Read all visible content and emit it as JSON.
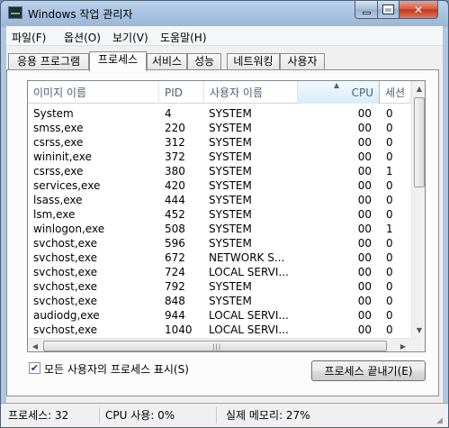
{
  "window": {
    "title": "Windows 작업 관리자",
    "minimize_glyph": "minimize-icon",
    "maximize_glyph": "maximize-icon",
    "close_glyph": "✕"
  },
  "menu": [
    "파일(F)",
    "옵션(O)",
    "보기(V)",
    "도움말(H)"
  ],
  "tabs": [
    {
      "label": "응용 프로그램",
      "active": false
    },
    {
      "label": "프로세스",
      "active": true
    },
    {
      "label": "서비스",
      "active": false
    },
    {
      "label": "성능",
      "active": false
    },
    {
      "label": "네트워킹",
      "active": false
    },
    {
      "label": "사용자",
      "active": false
    }
  ],
  "table": {
    "columns": [
      "이미지 이름",
      "PID",
      "사용자 이름",
      "CPU",
      "세션"
    ],
    "sorted_column": "CPU",
    "rows": [
      {
        "name": "System",
        "pid": "4",
        "user": "SYSTEM",
        "cpu": "00",
        "session": "0"
      },
      {
        "name": "smss,exe",
        "pid": "220",
        "user": "SYSTEM",
        "cpu": "00",
        "session": "0"
      },
      {
        "name": "csrss,exe",
        "pid": "312",
        "user": "SYSTEM",
        "cpu": "00",
        "session": "0"
      },
      {
        "name": "wininit,exe",
        "pid": "372",
        "user": "SYSTEM",
        "cpu": "00",
        "session": "0"
      },
      {
        "name": "csrss,exe",
        "pid": "380",
        "user": "SYSTEM",
        "cpu": "00",
        "session": "1"
      },
      {
        "name": "services,exe",
        "pid": "420",
        "user": "SYSTEM",
        "cpu": "00",
        "session": "0"
      },
      {
        "name": "lsass,exe",
        "pid": "444",
        "user": "SYSTEM",
        "cpu": "00",
        "session": "0"
      },
      {
        "name": "lsm,exe",
        "pid": "452",
        "user": "SYSTEM",
        "cpu": "00",
        "session": "0"
      },
      {
        "name": "winlogon,exe",
        "pid": "508",
        "user": "SYSTEM",
        "cpu": "00",
        "session": "1"
      },
      {
        "name": "svchost,exe",
        "pid": "596",
        "user": "SYSTEM",
        "cpu": "00",
        "session": "0"
      },
      {
        "name": "svchost,exe",
        "pid": "672",
        "user": "NETWORK S...",
        "cpu": "00",
        "session": "0"
      },
      {
        "name": "svchost,exe",
        "pid": "724",
        "user": "LOCAL SERVI...",
        "cpu": "00",
        "session": "0"
      },
      {
        "name": "svchost,exe",
        "pid": "792",
        "user": "SYSTEM",
        "cpu": "00",
        "session": "0"
      },
      {
        "name": "svchost,exe",
        "pid": "848",
        "user": "SYSTEM",
        "cpu": "00",
        "session": "0"
      },
      {
        "name": "audiodg,exe",
        "pid": "944",
        "user": "LOCAL SERVI...",
        "cpu": "00",
        "session": "0"
      },
      {
        "name": "svchost,exe",
        "pid": "1040",
        "user": "LOCAL SERVI...",
        "cpu": "00",
        "session": "0"
      }
    ]
  },
  "scroll_grip": "|||",
  "show_all_processes": {
    "label": "모든 사용자의 프로세스 표시(S)",
    "checked": true,
    "check_glyph": "✔"
  },
  "end_process_button": "프로세스 끝내기(E)",
  "status": {
    "processes": "프로세스: 32",
    "cpu_usage": "CPU 사용: 0%",
    "memory": "실제 메모리: 27%"
  },
  "icons": {
    "app": "task-manager-icon",
    "sort": "sort-ascending-icon",
    "scroll_up": "chevron-up-icon",
    "scroll_down": "chevron-down-icon",
    "scroll_left": "chevron-left-icon",
    "scroll_right": "chevron-right-icon"
  }
}
